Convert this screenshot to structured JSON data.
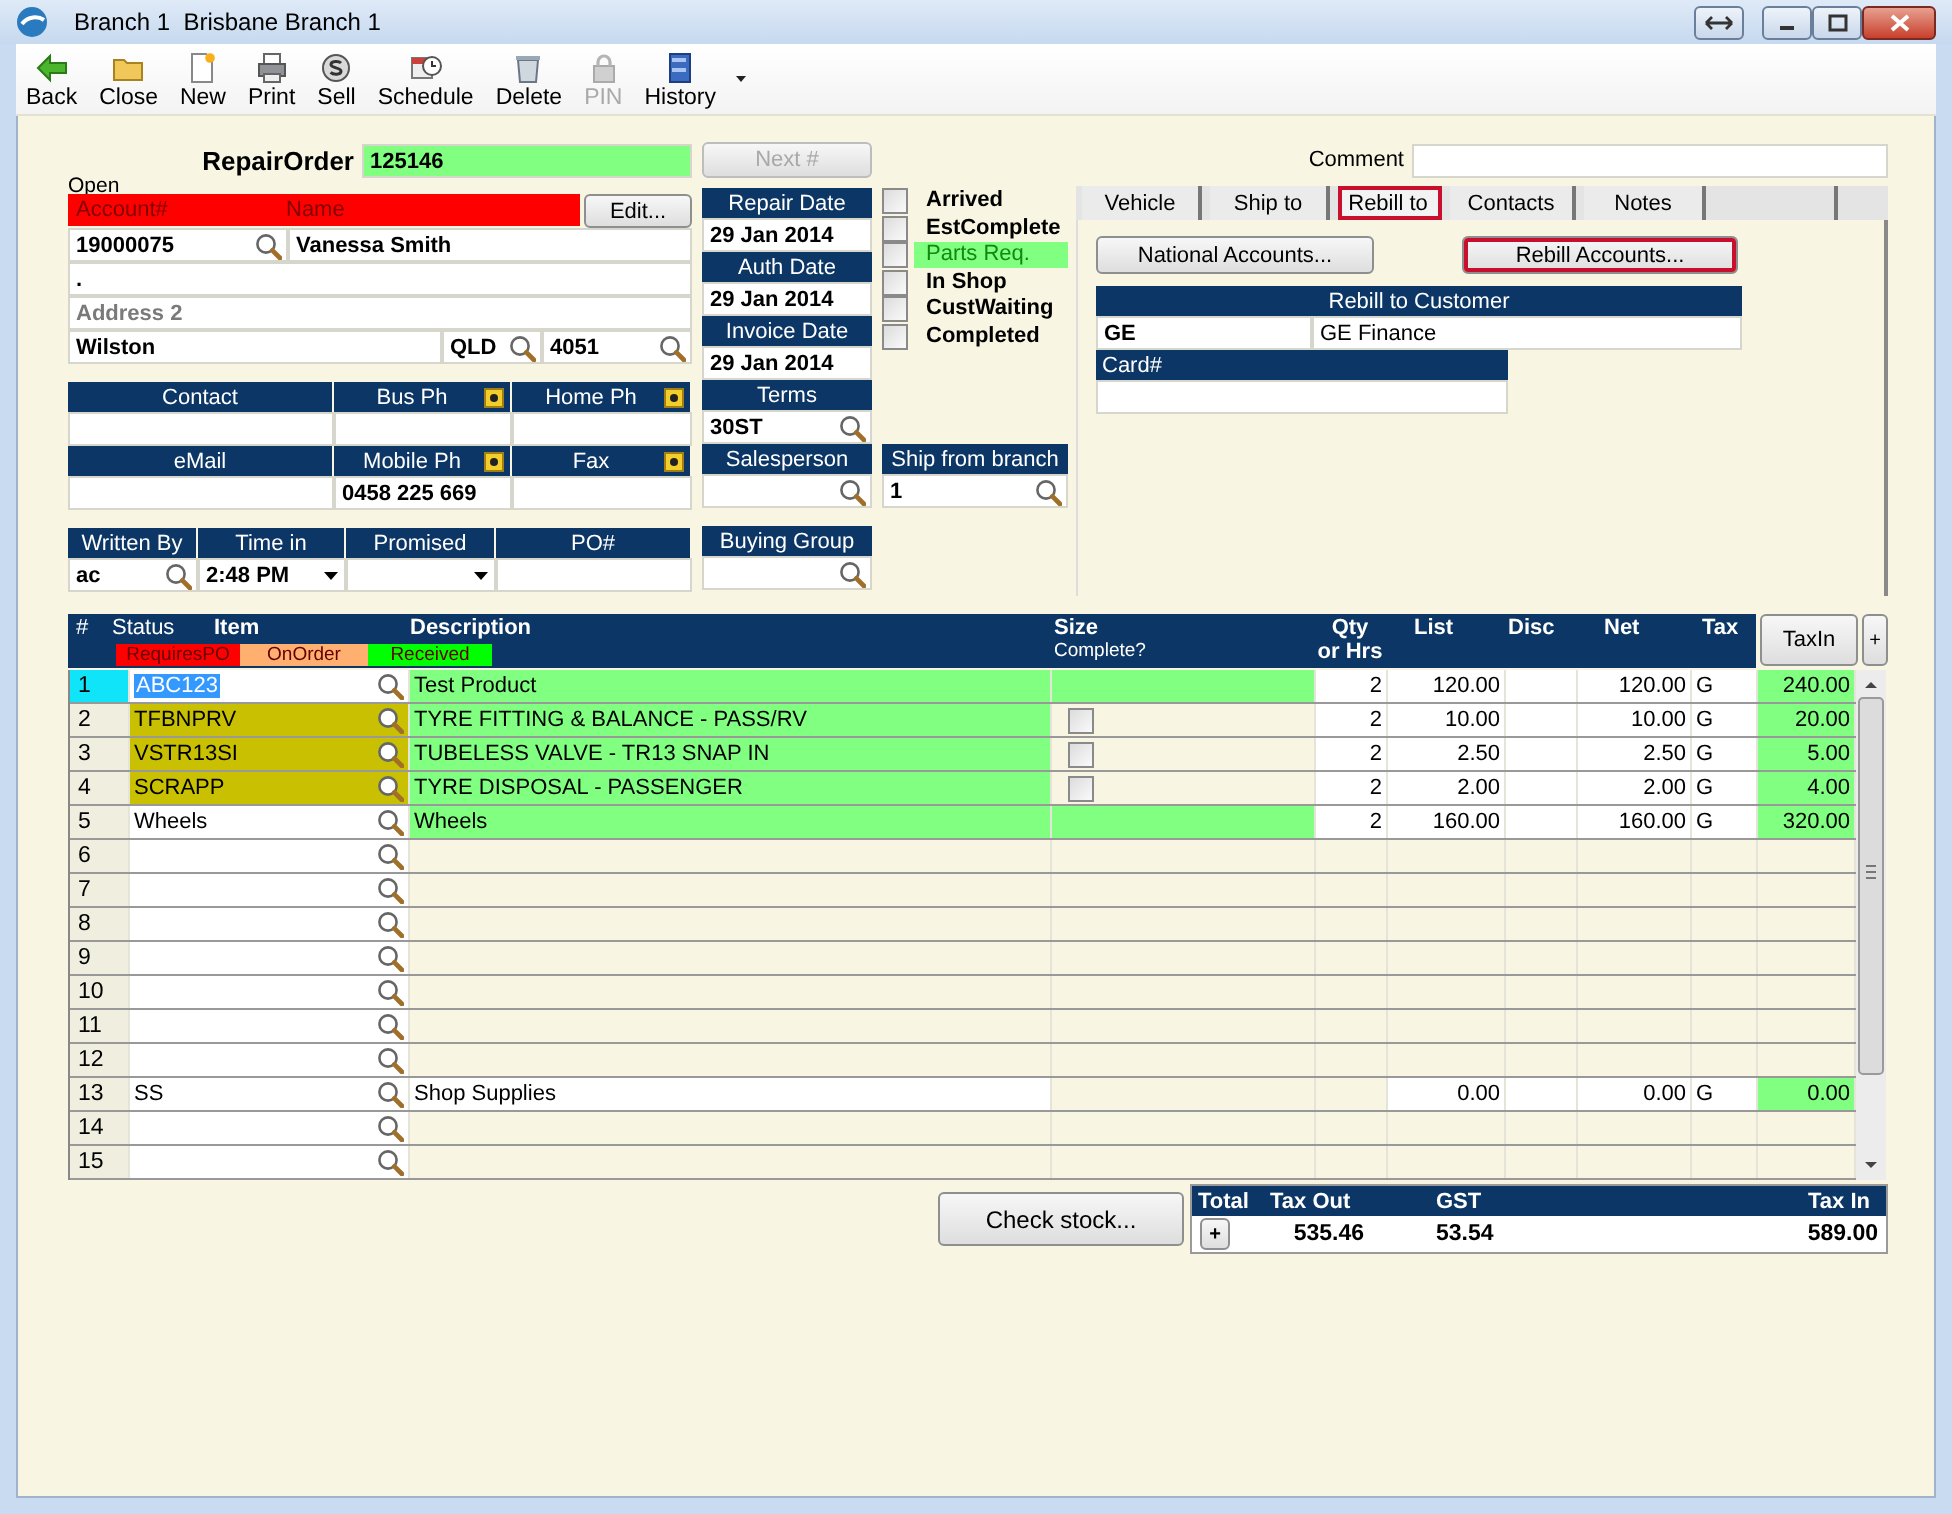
{
  "window": {
    "title": "Branch 1  Brisbane Branch 1"
  },
  "toolbar": [
    {
      "label": "Back",
      "kind": "back",
      "disabled": false
    },
    {
      "label": "Close",
      "kind": "close",
      "disabled": false
    },
    {
      "label": "New",
      "kind": "new",
      "disabled": false
    },
    {
      "label": "Print",
      "kind": "print",
      "disabled": false
    },
    {
      "label": "Sell",
      "kind": "sell",
      "disabled": false
    },
    {
      "label": "Schedule",
      "kind": "schedule",
      "disabled": false
    },
    {
      "label": "Delete",
      "kind": "delete",
      "disabled": false
    },
    {
      "label": "PIN",
      "kind": "pin",
      "disabled": true
    },
    {
      "label": "History",
      "kind": "history",
      "disabled": false
    }
  ],
  "order": {
    "label": "RepairOrder",
    "number": "125146",
    "status": "Open",
    "next_button": {
      "label": "Next #",
      "disabled": true
    }
  },
  "customer": {
    "headers": [
      "Account#",
      "Name"
    ],
    "edit_button": "Edit...",
    "account": "19000075",
    "name": "Vanessa Smith",
    "address_1": ".",
    "address_2": {
      "placeholder": "Address 2"
    },
    "suburb": "Wilston",
    "state": "QLD",
    "postcode": "4051"
  },
  "contact_fields": [
    {
      "label": "Contact",
      "kind": "text"
    },
    {
      "label": "Bus Ph",
      "kind": "phone"
    },
    {
      "label": "Home Ph",
      "kind": "phone"
    },
    {
      "label": "eMail",
      "kind": "text"
    },
    {
      "label": "Mobile Ph",
      "kind": "phone",
      "value": "0458 225 669"
    },
    {
      "label": "Fax",
      "kind": "phone"
    }
  ],
  "writer_fields": [
    {
      "label": "Written By",
      "kind": "lookup",
      "value": "ac"
    },
    {
      "label": "Time in",
      "kind": "dropdown",
      "value": "2:48 PM"
    },
    {
      "label": "Promised",
      "kind": "dropdown"
    },
    {
      "label": "PO#",
      "kind": "text"
    }
  ],
  "date_fields": [
    {
      "label": "Repair Date",
      "kind": "text",
      "value": "29 Jan 2014"
    },
    {
      "label": "Auth Date",
      "kind": "text",
      "value": "29 Jan 2014"
    },
    {
      "label": "Invoice Date",
      "kind": "text",
      "value": "29 Jan 2014"
    },
    {
      "label": "Terms",
      "kind": "lookup",
      "value": "30ST"
    },
    {
      "label": "Salesperson",
      "kind": "lookup"
    }
  ],
  "buying_group": {
    "label": "Buying Group"
  },
  "flags": [
    {
      "label": "Arrived",
      "checked": false,
      "highlighted": false
    },
    {
      "label": "EstComplete",
      "checked": false,
      "highlighted": false
    },
    {
      "label": "Parts Req.",
      "checked": false,
      "highlighted": true
    },
    {
      "label": "In Shop",
      "checked": false,
      "highlighted": false
    },
    {
      "label": "CustWaiting",
      "checked": false,
      "highlighted": false
    },
    {
      "label": "Completed",
      "checked": false,
      "highlighted": false
    }
  ],
  "ship_from": {
    "label": "Ship from branch",
    "value": "1"
  },
  "comment": {
    "label": "Comment"
  },
  "tabs": [
    {
      "label": "Vehicle",
      "selected": false
    },
    {
      "label": "Ship to",
      "selected": false
    },
    {
      "label": "Rebill to",
      "selected": true
    },
    {
      "label": "Contacts",
      "selected": false
    },
    {
      "label": "Notes",
      "selected": false
    }
  ],
  "rebill": {
    "buttons": [
      {
        "label": "National Accounts...",
        "highlighted": false
      },
      {
        "label": "Rebill Accounts...",
        "highlighted": true
      }
    ],
    "header": "Rebill to Customer",
    "code": "GE",
    "name": "GE Finance",
    "card_label": "Card#"
  },
  "lines": {
    "columns": [
      {
        "label": "#"
      },
      {
        "label": "Status"
      },
      {
        "label": "Item"
      },
      {
        "label": "Description"
      },
      {
        "label": "Size",
        "sub": "Complete?"
      },
      {
        "label": "Qty",
        "sub": "or Hrs"
      },
      {
        "label": "List"
      },
      {
        "label": "Disc"
      },
      {
        "label": "Net"
      },
      {
        "label": "Tax"
      }
    ],
    "legend": [
      {
        "label": "RequiresPO",
        "color": "#ff0000"
      },
      {
        "label": "OnOrder",
        "color": "#ffb070"
      },
      {
        "label": "Received",
        "color": "#00ff00"
      }
    ],
    "taxin_button": "TaxIn",
    "add_button": "+",
    "rows": [
      {
        "num": "1",
        "item": "ABC123",
        "description": "Test Product",
        "received": true,
        "qty": "2",
        "list": "120.00",
        "net": "120.00",
        "tax": "G",
        "tax_in": "240.00",
        "selected": true
      },
      {
        "num": "2",
        "item": "TFBNPRV",
        "color": "#c8c000",
        "description": "TYRE FITTING & BALANCE - PASS/RV",
        "received": true,
        "complete": false,
        "qty": "2",
        "list": "10.00",
        "net": "10.00",
        "tax": "G",
        "tax_in": "20.00",
        "selected": false
      },
      {
        "num": "3",
        "item": "VSTR13SI",
        "color": "#c8c000",
        "description": "TUBELESS VALVE - TR13 SNAP IN",
        "received": true,
        "complete": false,
        "qty": "2",
        "list": "2.50",
        "net": "2.50",
        "tax": "G",
        "tax_in": "5.00",
        "selected": false
      },
      {
        "num": "4",
        "item": "SCRAPP",
        "color": "#c8c000",
        "description": "TYRE DISPOSAL - PASSENGER",
        "received": true,
        "complete": false,
        "qty": "2",
        "list": "2.00",
        "net": "2.00",
        "tax": "G",
        "tax_in": "4.00",
        "selected": false
      },
      {
        "num": "5",
        "item": "Wheels",
        "description": "Wheels",
        "received": true,
        "qty": "2",
        "list": "160.00",
        "net": "160.00",
        "tax": "G",
        "tax_in": "320.00",
        "selected": false
      },
      {
        "num": "6",
        "received": false,
        "selected": false
      },
      {
        "num": "7",
        "received": false,
        "selected": false
      },
      {
        "num": "8",
        "received": false,
        "selected": false
      },
      {
        "num": "9",
        "received": false,
        "selected": false
      },
      {
        "num": "10",
        "received": false,
        "selected": false
      },
      {
        "num": "11",
        "received": false,
        "selected": false
      },
      {
        "num": "12",
        "received": false,
        "selected": false
      },
      {
        "num": "13",
        "item": "SS",
        "description": "Shop Supplies",
        "received": false,
        "list": "0.00",
        "net": "0.00",
        "tax": "G",
        "tax_in": "0.00",
        "selected": false
      },
      {
        "num": "14",
        "received": false,
        "selected": false
      },
      {
        "num": "15",
        "received": false,
        "selected": false
      }
    ]
  },
  "check_stock_button": "Check stock...",
  "totals": {
    "headers": [
      "Total",
      "Tax Out",
      "GST",
      "Tax In"
    ],
    "expand_button": "+",
    "values": [
      "535.46",
      "53.54",
      "589.00"
    ]
  }
}
